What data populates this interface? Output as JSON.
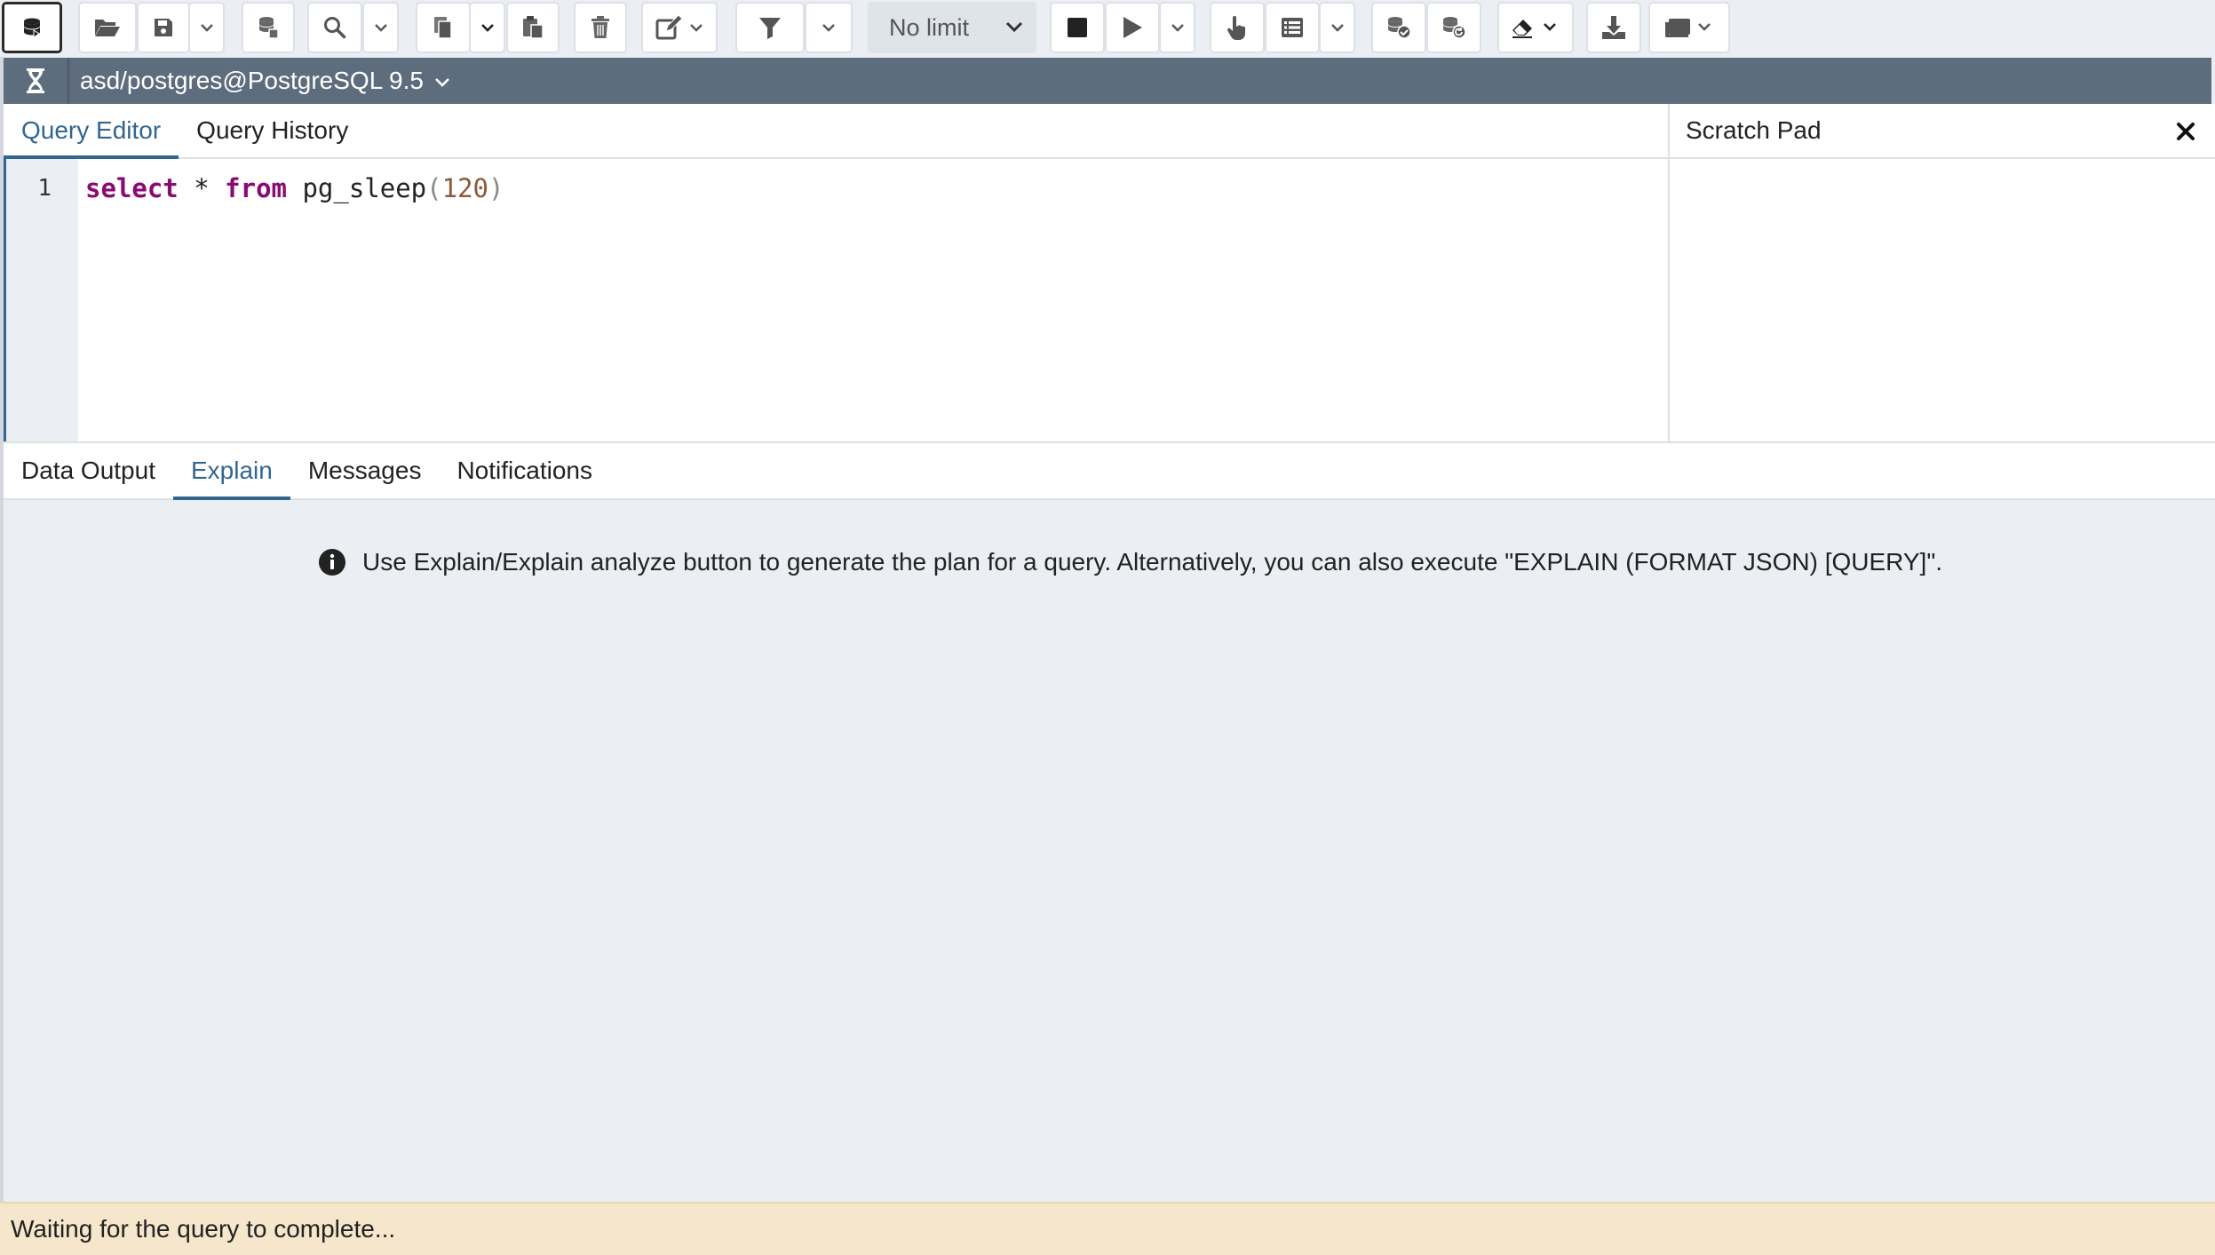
{
  "toolbar": {
    "buttons": [
      {
        "name": "database-icon"
      },
      {
        "name": "open-file-icon"
      },
      {
        "name": "save-icon"
      },
      {
        "name": "save-dropdown-icon"
      },
      {
        "name": "save-data-icon"
      },
      {
        "name": "find-icon"
      },
      {
        "name": "find-dropdown-icon"
      },
      {
        "name": "copy-icon"
      },
      {
        "name": "copy-dropdown-icon"
      },
      {
        "name": "paste-icon"
      },
      {
        "name": "delete-icon"
      },
      {
        "name": "edit-icon"
      },
      {
        "name": "filter-icon"
      },
      {
        "name": "filter-dropdown-icon"
      },
      {
        "name": "stop-icon"
      },
      {
        "name": "execute-icon"
      },
      {
        "name": "execute-dropdown-icon"
      },
      {
        "name": "explain-icon"
      },
      {
        "name": "explain-analyze-icon"
      },
      {
        "name": "explain-dropdown-icon"
      },
      {
        "name": "commit-icon"
      },
      {
        "name": "rollback-icon"
      },
      {
        "name": "clear-icon"
      },
      {
        "name": "download-icon"
      },
      {
        "name": "macros-icon"
      }
    ],
    "limit_label": "No limit"
  },
  "connection": {
    "label": "asd/postgres@PostgreSQL 9.5",
    "icon": "hourglass-icon"
  },
  "editor": {
    "tabs": [
      {
        "label": "Query Editor",
        "active": true
      },
      {
        "label": "Query History",
        "active": false
      }
    ],
    "line_number": "1",
    "code": {
      "kw1": "select",
      "star": " * ",
      "kw2": "from",
      "fn": " pg_sleep",
      "lparen": "(",
      "arg": "120",
      "rparen": ")"
    }
  },
  "scratch_pad": {
    "title": "Scratch Pad",
    "close_icon": "close-icon"
  },
  "output": {
    "tabs": [
      {
        "label": "Data Output",
        "active": false
      },
      {
        "label": "Explain",
        "active": true
      },
      {
        "label": "Messages",
        "active": false
      },
      {
        "label": "Notifications",
        "active": false
      }
    ],
    "explain_message": "Use Explain/Explain analyze button to generate the plan for a query. Alternatively, you can also execute \"EXPLAIN (FORMAT JSON) [QUERY]\".",
    "info_icon": "info-icon"
  },
  "status": {
    "text": "Waiting for the query to complete..."
  },
  "colors": {
    "accent": "#326690",
    "connbar": "#5e6d7e",
    "status_bg": "#f6e7cc",
    "keyword": "#8a0b73",
    "number": "#8b5b3b"
  }
}
